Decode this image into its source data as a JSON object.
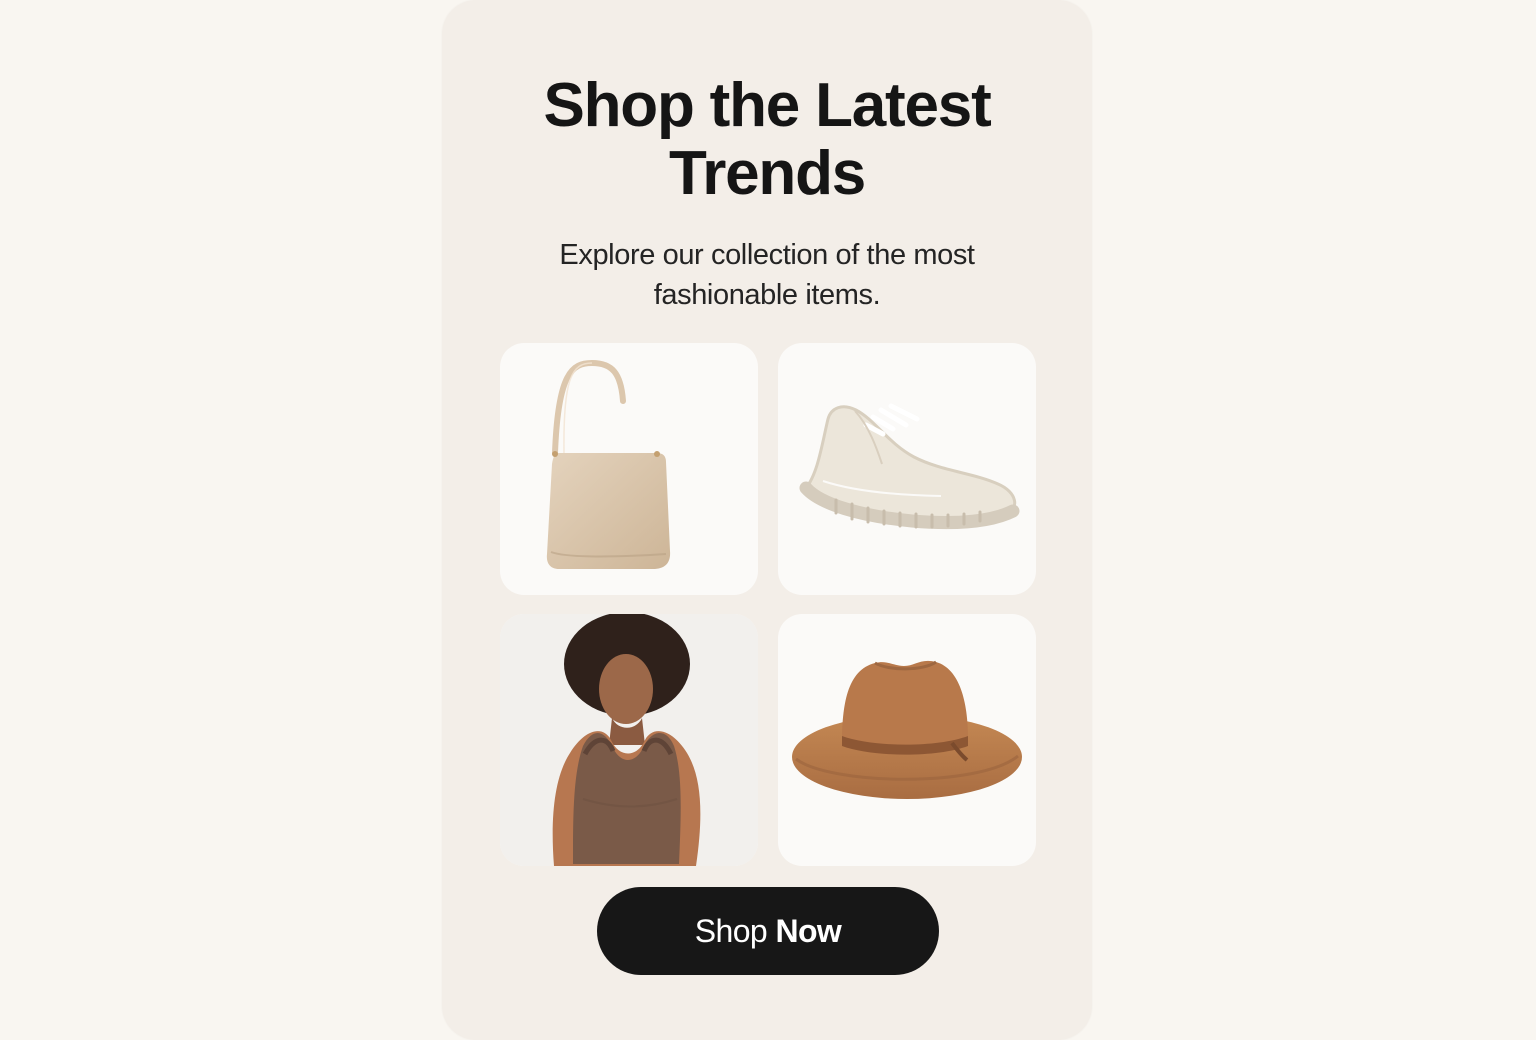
{
  "hero": {
    "title_line_1": "Shop the Latest",
    "title_line_2": "Trends",
    "subtitle": "Explore our collection of the most fashionable items."
  },
  "products": [
    {
      "icon": "handbag-icon"
    },
    {
      "icon": "sneaker-icon"
    },
    {
      "icon": "tank-top-icon"
    },
    {
      "icon": "fedora-hat-icon"
    }
  ],
  "cta": {
    "label_part_1": "Shop",
    "label_part_2": "Now"
  },
  "colors": {
    "page_background": "#f9f6f1",
    "card_background": "#f3eee8",
    "tile_background": "#fbfaf8",
    "button_background": "#171717",
    "button_text": "#ffffff",
    "bag": "#dcc7ad",
    "shoe": "#ece6da",
    "top": "#7a5a48",
    "hat": "#b8794b"
  }
}
